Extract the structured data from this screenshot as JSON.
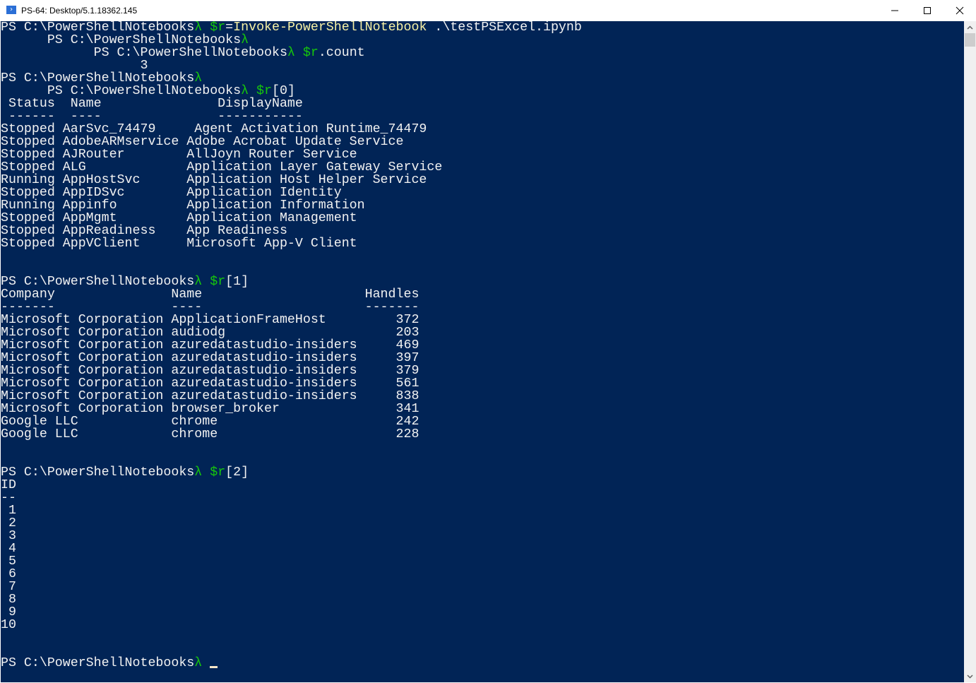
{
  "window": {
    "title": "PS-64: Desktop/5.1.18362.145"
  },
  "colors": {
    "background": "#012456",
    "green": "#16c60c",
    "yellow": "#f9f1a5",
    "white": "#f2f2f2"
  },
  "console": {
    "lines": [
      [
        [
          "PS C:\\PowerShellNotebooks",
          "white"
        ],
        [
          "λ",
          "green"
        ],
        [
          " $r",
          "green"
        ],
        [
          "=",
          "white"
        ],
        [
          "Invoke-PowerShellNotebook",
          "yellow"
        ],
        [
          " .\\testPSExcel.ipynb",
          "white"
        ]
      ],
      [
        [
          "      PS C:\\PowerShellNotebooks",
          "white"
        ],
        [
          "λ",
          "green"
        ]
      ],
      [
        [
          "            PS C:\\PowerShellNotebooks",
          "white"
        ],
        [
          "λ",
          "green"
        ],
        [
          " $r",
          "green"
        ],
        [
          ".count",
          "white"
        ]
      ],
      [
        [
          "                  3",
          "white"
        ]
      ],
      [
        [
          "PS C:\\PowerShellNotebooks",
          "white"
        ],
        [
          "λ",
          "green"
        ]
      ],
      [
        [
          "      PS C:\\PowerShellNotebooks",
          "white"
        ],
        [
          "λ",
          "green"
        ],
        [
          " $r",
          "green"
        ],
        [
          "[0]",
          "white"
        ]
      ],
      [
        [
          " Status  Name               DisplayName",
          "white"
        ]
      ],
      [
        [
          " ------  ----               -----------",
          "white"
        ]
      ],
      [
        [
          "Stopped AarSvc_74479     Agent Activation Runtime_74479",
          "white"
        ]
      ],
      [
        [
          "Stopped AdobeARMservice Adobe Acrobat Update Service",
          "white"
        ]
      ],
      [
        [
          "Stopped AJRouter        AllJoyn Router Service",
          "white"
        ]
      ],
      [
        [
          "Stopped ALG             Application Layer Gateway Service",
          "white"
        ]
      ],
      [
        [
          "Running AppHostSvc      Application Host Helper Service",
          "white"
        ]
      ],
      [
        [
          "Stopped AppIDSvc        Application Identity",
          "white"
        ]
      ],
      [
        [
          "Running Appinfo         Application Information",
          "white"
        ]
      ],
      [
        [
          "Stopped AppMgmt         Application Management",
          "white"
        ]
      ],
      [
        [
          "Stopped AppReadiness    App Readiness",
          "white"
        ]
      ],
      [
        [
          "Stopped AppVClient      Microsoft App-V Client",
          "white"
        ]
      ],
      [],
      [],
      [
        [
          "PS C:\\PowerShellNotebooks",
          "white"
        ],
        [
          "λ",
          "green"
        ],
        [
          " $r",
          "green"
        ],
        [
          "[1]",
          "white"
        ]
      ],
      [
        [
          "Company               Name                     Handles",
          "white"
        ]
      ],
      [
        [
          "-------               ----                     -------",
          "white"
        ]
      ],
      [
        [
          "Microsoft Corporation ApplicationFrameHost         372",
          "white"
        ]
      ],
      [
        [
          "Microsoft Corporation audiodg                      203",
          "white"
        ]
      ],
      [
        [
          "Microsoft Corporation azuredatastudio-insiders     469",
          "white"
        ]
      ],
      [
        [
          "Microsoft Corporation azuredatastudio-insiders     397",
          "white"
        ]
      ],
      [
        [
          "Microsoft Corporation azuredatastudio-insiders     379",
          "white"
        ]
      ],
      [
        [
          "Microsoft Corporation azuredatastudio-insiders     561",
          "white"
        ]
      ],
      [
        [
          "Microsoft Corporation azuredatastudio-insiders     838",
          "white"
        ]
      ],
      [
        [
          "Microsoft Corporation browser_broker               341",
          "white"
        ]
      ],
      [
        [
          "Google LLC            chrome                       242",
          "white"
        ]
      ],
      [
        [
          "Google LLC            chrome                       228",
          "white"
        ]
      ],
      [],
      [],
      [
        [
          "PS C:\\PowerShellNotebooks",
          "white"
        ],
        [
          "λ",
          "green"
        ],
        [
          " $r",
          "green"
        ],
        [
          "[2]",
          "white"
        ]
      ],
      [
        [
          "ID",
          "white"
        ]
      ],
      [
        [
          "--",
          "white"
        ]
      ],
      [
        [
          " 1",
          "white"
        ]
      ],
      [
        [
          " 2",
          "white"
        ]
      ],
      [
        [
          " 3",
          "white"
        ]
      ],
      [
        [
          " 4",
          "white"
        ]
      ],
      [
        [
          " 5",
          "white"
        ]
      ],
      [
        [
          " 6",
          "white"
        ]
      ],
      [
        [
          " 7",
          "white"
        ]
      ],
      [
        [
          " 8",
          "white"
        ]
      ],
      [
        [
          " 9",
          "white"
        ]
      ],
      [
        [
          "10",
          "white"
        ]
      ],
      [],
      [],
      [
        [
          "PS C:\\PowerShellNotebooks",
          "white"
        ],
        [
          "λ",
          "green"
        ],
        [
          " ",
          "white"
        ]
      ]
    ]
  }
}
